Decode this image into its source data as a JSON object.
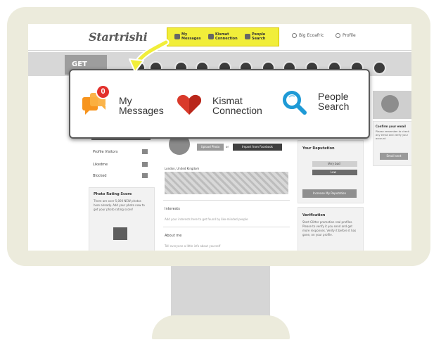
{
  "site": {
    "logo": "Startrishi"
  },
  "header_nav_small": [
    {
      "label": "My Messages",
      "icon": "messages-icon"
    },
    {
      "label": "Kismat Connection",
      "icon": "heart-icon"
    },
    {
      "label": "People Search",
      "icon": "search-icon"
    }
  ],
  "header_right": {
    "user": "Big Ecoafric",
    "profile": "Profile"
  },
  "band": {
    "tab_label": "GET"
  },
  "left_menu": [
    {
      "label": "Profile Visitors"
    },
    {
      "label": "Likedme"
    },
    {
      "label": "Blocked"
    }
  ],
  "photo_rating": {
    "title": "Photo Rating Score",
    "text": "There are over 5,000 NEW photos here already. Add your photo now to get your photo rating score!"
  },
  "center": {
    "upload_button": "Upload Photo",
    "or_text": "or",
    "import_button": "Import from Facebook",
    "location": "London, United Kingdom",
    "interests_label": "Interests",
    "interests_hint": "Add your interests here to get found by like-minded people",
    "about_label": "About me",
    "about_hint": "Tell everyone a little info about yourself"
  },
  "right": {
    "reputation_title": "Your Reputation",
    "very_bad": "Very bad",
    "low": "Low",
    "increase_button": "Increase My Reputation",
    "verification_title": "Verification",
    "verification_text": "Start Glitter promotion real profiles. Please to verify it you send and get more responses. Verify it before it has gone, on your profile.",
    "confirm_title": "Confirm your email",
    "confirm_text": "Please remember to check any email and verify your account",
    "email_button": "Email sent"
  },
  "callout": {
    "items": [
      {
        "label_line1": "My",
        "label_line2": "Messages",
        "icon": "messages-icon",
        "badge": "0"
      },
      {
        "label_line1": "Kismat",
        "label_line2": "Connection",
        "icon": "heart-icon"
      },
      {
        "label_line1": "People",
        "label_line2": "Search",
        "icon": "search-icon"
      }
    ]
  },
  "colors": {
    "highlight": "#f1ee3a",
    "badge": "#e2302b",
    "messages_orange": "#f7941d",
    "heart_red": "#d93a2b",
    "search_blue": "#1e9ad6",
    "frame": "#ecebdc"
  }
}
